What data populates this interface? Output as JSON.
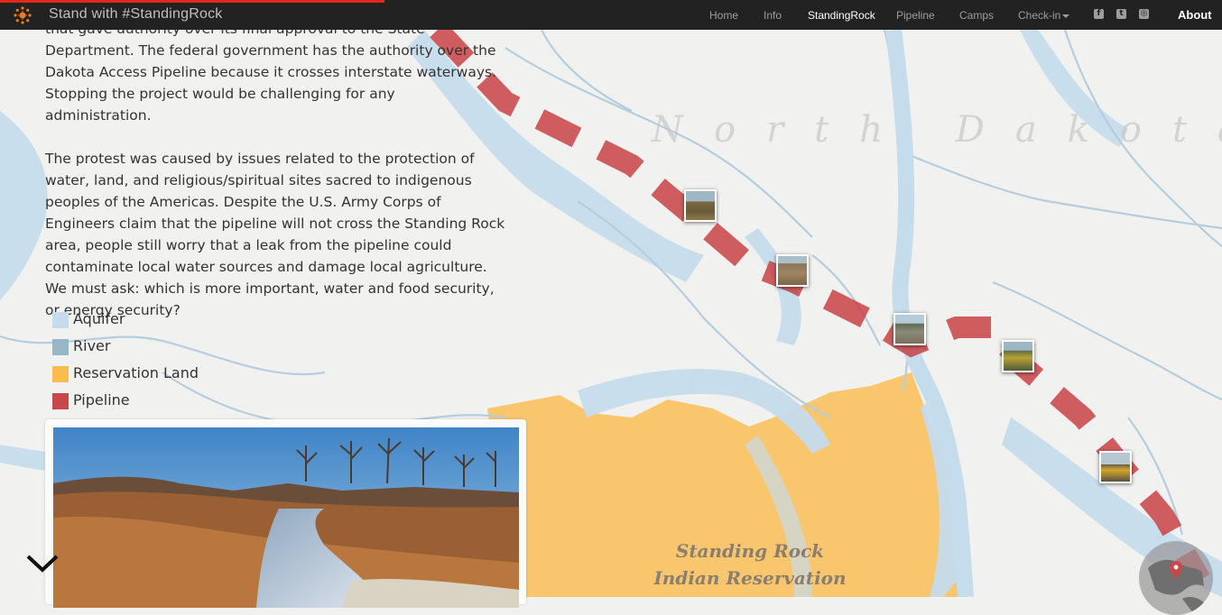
{
  "nav": {
    "brand": "Stand with #StandingRock",
    "items": [
      "Home",
      "Info",
      "StandingRock",
      "Pipeline",
      "Camps",
      "Check-in"
    ],
    "active": "StandingRock",
    "about": "About",
    "social_icons": [
      "facebook-icon",
      "twitter-icon",
      "instagram-icon"
    ]
  },
  "content": {
    "paragraph1": "that gave authority over its final approval to the State Department. The federal government has the authority over the Dakota Access Pipeline because it crosses interstate waterways. Stopping the project would be challenging for any administration.",
    "paragraph2": "The protest was caused by issues related to the protection of water, land, and religious/spiritual sites sacred to indigenous peoples of the Americas. Despite the U.S. Army Corps of Engineers claim that the pipeline will not cross the Standing Rock area, people still worry that a leak from the pipeline could contaminate local water sources and damage local agriculture. We must ask: which is more important, water and food security, or energy security?"
  },
  "legend": [
    {
      "label": "Aquifer",
      "color": "#c5dcec"
    },
    {
      "label": "River",
      "color": "#96b7c6"
    },
    {
      "label": "Reservation Land",
      "color": "#f9bd4d"
    },
    {
      "label": "Pipeline",
      "color": "#c9474b"
    }
  ],
  "map": {
    "state_label": "North Dakota",
    "reservation_label_line1": "Standing Rock",
    "reservation_label_line2": "Indian Reservation",
    "colors": {
      "water": "#c5dcec",
      "river_line": "#b4cede",
      "reservation": "#f9c66e",
      "pipeline": "#c9474b",
      "background": "#f1f1ef"
    }
  }
}
